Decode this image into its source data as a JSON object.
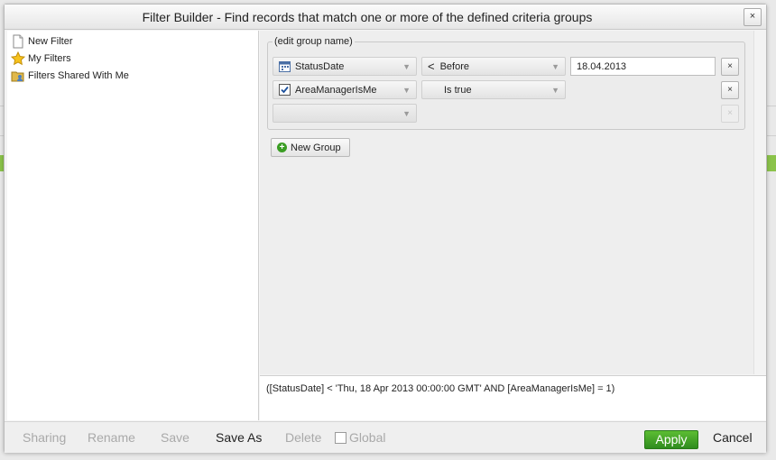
{
  "dialog": {
    "title": "Filter Builder - Find records that match one or more of the defined criteria groups",
    "close_label": "×"
  },
  "tree": {
    "items": [
      {
        "label": "New Filter",
        "icon": "document-icon"
      },
      {
        "label": "My Filters",
        "icon": "star-icon"
      },
      {
        "label": "Filters Shared With Me",
        "icon": "shared-folder-icon"
      }
    ]
  },
  "group": {
    "name_label": "(edit group name)",
    "rows": [
      {
        "field": "StatusDate",
        "field_icon": "calendar-icon",
        "operator": "Before",
        "operator_icon": "less-than-icon",
        "value": "18.04.2013",
        "remove_label": "×"
      },
      {
        "field": "AreaManagerIsMe",
        "field_icon": "checkbox-icon",
        "operator": "Is true",
        "remove_label": "×"
      },
      {
        "field": "",
        "remove_label": "×"
      }
    ],
    "caret": "▼"
  },
  "new_group_label": "New Group",
  "expression": "([StatusDate] < 'Thu, 18 Apr 2013 00:00:00 GMT' AND [AreaManagerIsMe] = 1)",
  "toolbar": {
    "sharing": "Sharing",
    "rename": "Rename",
    "save": "Save",
    "save_as": "Save As",
    "delete": "Delete",
    "global": "Global",
    "apply": "Apply",
    "cancel": "Cancel"
  },
  "colors": {
    "accent_green": "#3a9d23",
    "apply_green": "#2f8c1e"
  }
}
